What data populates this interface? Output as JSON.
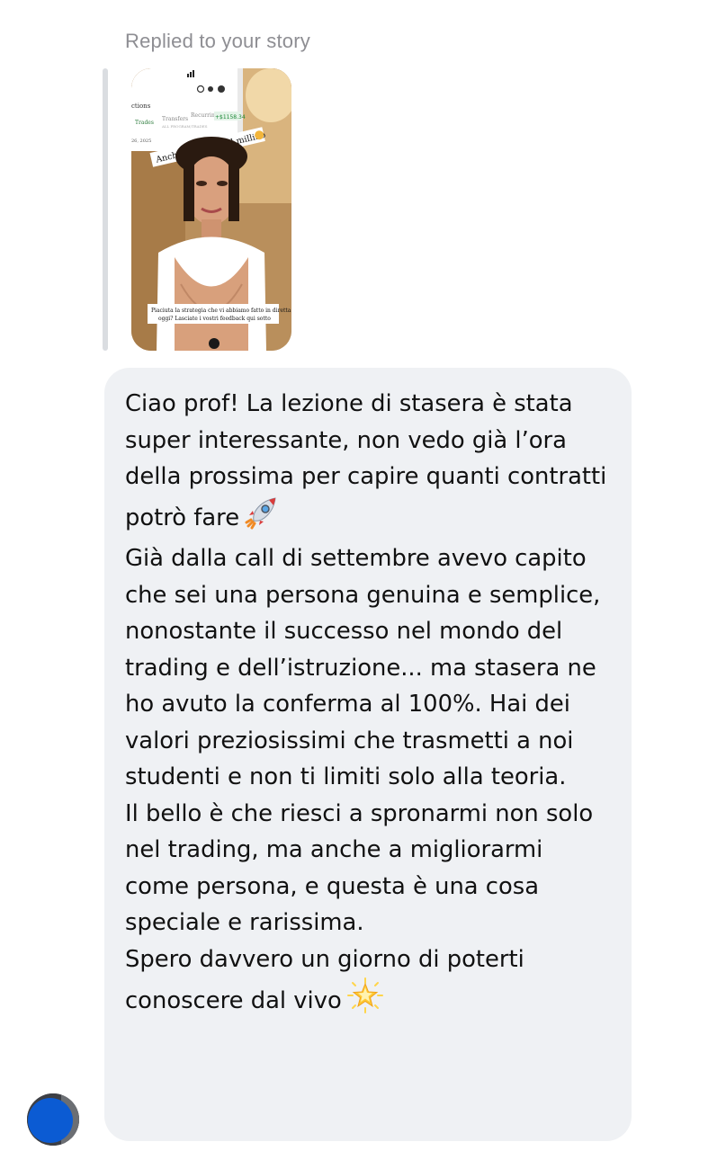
{
  "reply": {
    "label": "Replied to your story"
  },
  "story": {
    "image_alt": "Story thumbnail",
    "overlay_caption": "Anche oggi fatto il millino",
    "bottom_caption_line1": "Piaciuta la strategia che vi abbiamo fatto in diretta",
    "bottom_caption_line2": "oggi? Lasciate i vostri feedback qui sotto",
    "screen_label": "ctions",
    "tabs": [
      "Trades",
      "Transfers",
      "Recurring"
    ],
    "amount": "+$1158.34",
    "date": "26, 2025",
    "sublabel": "ALL PROGRAM/TRADES"
  },
  "message": {
    "paragraphs": [
      "Ciao prof! La lezione di stasera è stata super interessante, non vedo già l’ora della prossima per capire quanti contratti potrò fare",
      "Già dalla call di settembre avevo capito che sei una persona genuina e semplice, nonostante il successo nel mondo del trading e dell’istruzione... ma stasera ne ho avuto la conferma al 100%. Hai dei valori preziosissimi che trasmetti a noi studenti e non ti limiti solo alla teoria.",
      "Il bello è che riesci a spronarmi non solo nel trading, ma anche a migliorarmi come persona, e questa è una cosa speciale e rarissima.",
      "Spero davvero un giorno di poterti conoscere dal vivo"
    ],
    "emoji_1": "rocket-emoji",
    "emoji_2": "glowing-star-emoji"
  },
  "colors": {
    "bubble_bg": "#eff1f4",
    "text": "#111111",
    "header": "#8e8e93",
    "reply_bar": "#dadde1",
    "avatar_blue": "#0b5bd3"
  }
}
